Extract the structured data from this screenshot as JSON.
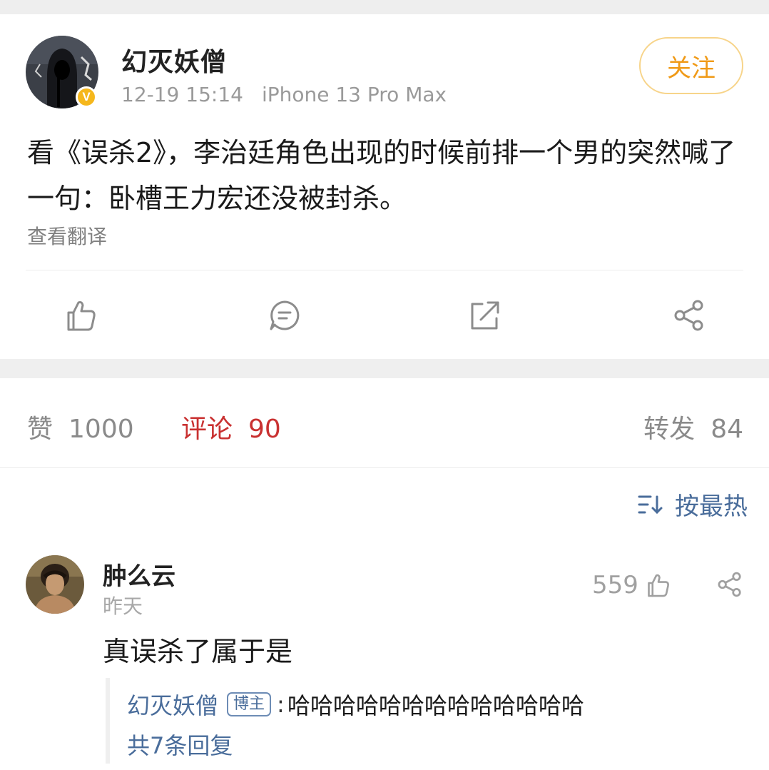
{
  "post": {
    "author": "幻灭妖僧",
    "verified_badge": "V",
    "time": "12-19 15:14",
    "device": "iPhone 13 Pro Max",
    "follow_label": "关注",
    "text": "看《误杀2》，李治廷角色出现的时候前排一个男的突然喊了一句：卧槽王力宏还没被封杀。",
    "translate_label": "查看翻译",
    "actions": [
      "like-icon",
      "comment-icon",
      "repost-icon",
      "share-icon"
    ]
  },
  "stats": {
    "likes_label": "赞",
    "likes_count": "1000",
    "comments_label": "评论",
    "comments_count": "90",
    "reposts_label": "转发",
    "reposts_count": "84"
  },
  "sort": {
    "label": "按最热",
    "icon": "sort-icon"
  },
  "comment": {
    "author": "肿么云",
    "time": "昨天",
    "likes": "559",
    "text": "真误杀了属于是",
    "reply": {
      "author": "幻灭妖僧",
      "tag": "博主",
      "sep": ":",
      "text": "哈哈哈哈哈哈哈哈哈哈哈哈哈",
      "more_label": "共7条回复"
    }
  },
  "colors": {
    "accent_orange": "#f09a17",
    "link_blue": "#4a6d9b",
    "comment_red": "#c93131",
    "badge_gold": "#f5b71c"
  }
}
